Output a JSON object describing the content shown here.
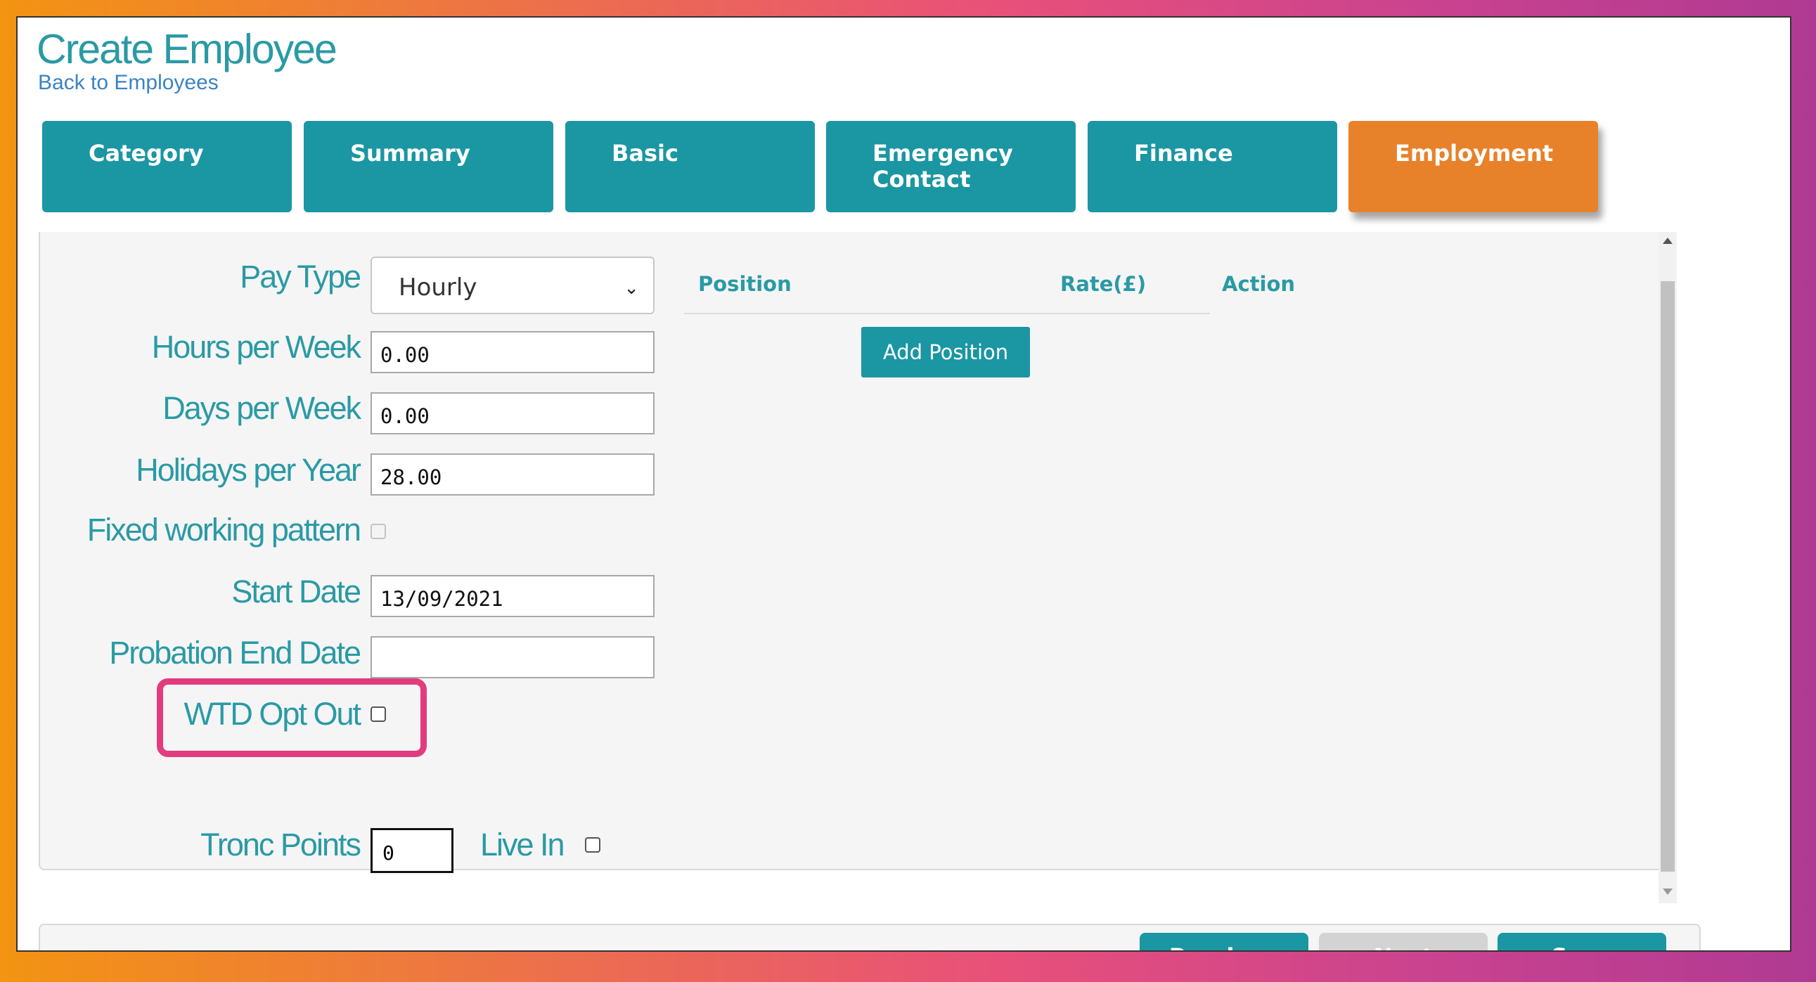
{
  "page": {
    "title": "Create Employee",
    "back_link": "Back to Employees"
  },
  "tabs": [
    {
      "label": "Category"
    },
    {
      "label": "Summary"
    },
    {
      "label": "Basic"
    },
    {
      "label": "Emergency Contact"
    },
    {
      "label": "Finance"
    },
    {
      "label": "Employment",
      "active": true
    }
  ],
  "form": {
    "pay_type": {
      "label": "Pay Type",
      "value": "Hourly"
    },
    "hours_per_week": {
      "label": "Hours per Week",
      "value": "0.00"
    },
    "days_per_week": {
      "label": "Days per Week",
      "value": "0.00"
    },
    "holidays_per_year": {
      "label": "Holidays per Year",
      "value": "28.00"
    },
    "fixed_working_pattern": {
      "label": "Fixed working pattern",
      "checked": false,
      "disabled": true
    },
    "start_date": {
      "label": "Start Date",
      "value": "13/09/2021"
    },
    "probation_end_date": {
      "label": "Probation End Date",
      "value": ""
    },
    "wtd_opt_out": {
      "label": "WTD Opt Out",
      "checked": false
    },
    "tronc_points": {
      "label": "Tronc Points",
      "value": "0"
    },
    "live_in": {
      "label": "Live In",
      "checked": false
    }
  },
  "positions_table": {
    "headers": [
      "Position",
      "Rate(£)",
      "Action"
    ],
    "add_button": "Add Position"
  },
  "footer": {
    "previous": "Previous",
    "next": "Next",
    "save": "Save"
  },
  "colors": {
    "teal": "#1b96a3",
    "orange_active": "#e8822a",
    "highlight_pink": "#e23c7d",
    "label_teal": "#2a9aa5",
    "disabled_grey": "#d3d3d3"
  }
}
